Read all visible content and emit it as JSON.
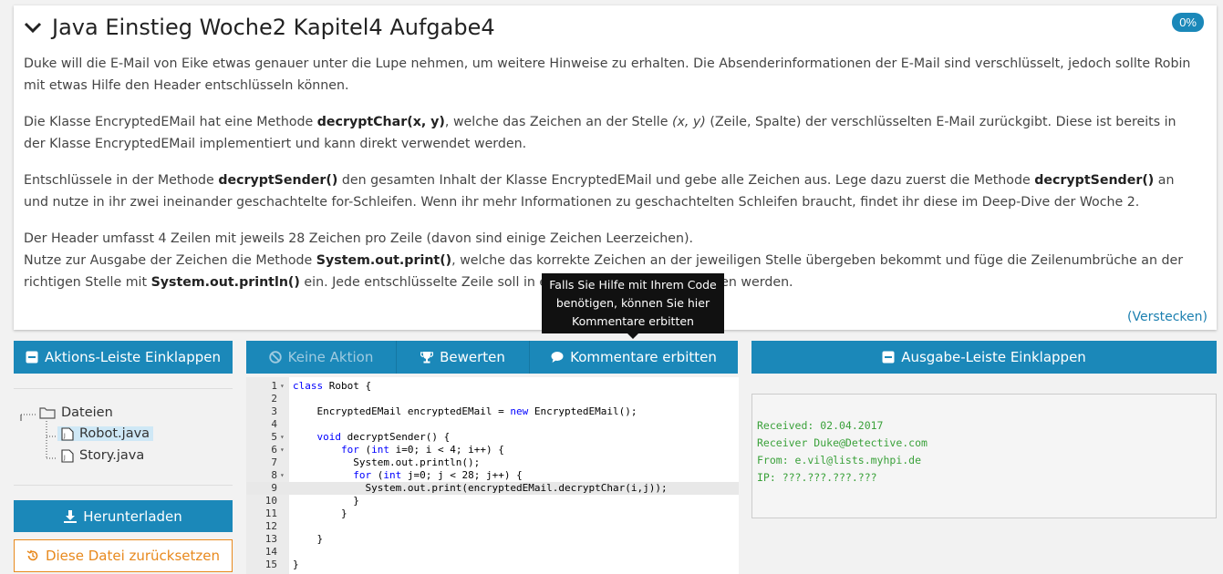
{
  "task": {
    "title": "Java Einstieg Woche2 Kapitel4 Aufgabe4",
    "progress": "0%",
    "p1": "Duke will die E-Mail von Eike etwas genauer unter die Lupe nehmen, um weitere Hinweise zu erhalten. Die Absenderinformationen der E-Mail sind verschlüsselt, jedoch sollte Robin mit etwas Hilfe den Header entschlüsseln können.",
    "p2_a": "Die Klasse EncryptedEMail hat eine Methode ",
    "p2_b": "decryptChar(x, y)",
    "p2_c": ", welche das Zeichen an der Stelle ",
    "p2_d": "(x, y)",
    "p2_e": " (Zeile, Spalte) der verschlüsselten E-Mail zurückgibt. Diese ist bereits in der Klasse EncryptedEMail implementiert und kann direkt verwendet werden.",
    "p3_a": "Entschlüssele in der Methode ",
    "p3_b": "decryptSender()",
    "p3_c": " den gesamten Inhalt der Klasse EncryptedEMail und gebe alle Zeichen aus. Lege dazu zuerst die Methode ",
    "p3_d": "decryptSender()",
    "p3_e": " an und nutze in ihr zwei ineinander geschachtelte for-Schleifen. Wenn ihr mehr Informationen zu geschachtelten Schleifen braucht, findet ihr diese im Deep-Dive der Woche 2.",
    "p4_a": "Der Header umfasst 4 Zeilen mit jeweils 28 Zeichen pro Zeile (davon sind einige Zeichen Leerzeichen).",
    "p4_b": "Nutze zur Ausgabe der Zeichen die Methode ",
    "p4_c": "System.out.print()",
    "p4_d": ", welche das korrekte Zeichen an der jeweiligen Stelle übergeben bekommt und füge die Zeilenumbrüche an der richtigen Stelle mit ",
    "p4_e": "System.out.println()",
    "p4_f": " ein. Jede entschlüsselte Zeile soll in einer neuen Zeile ausgegeben werden.",
    "hide_link": "(Verstecken)"
  },
  "tooltip": {
    "text": "Falls Sie Hilfe mit Ihrem Code benötigen, können Sie hier Kommentare erbitten"
  },
  "toolbar": {
    "collapse_actions": "Aktions-Leiste Einklappen",
    "no_action": "Keine Aktion",
    "rate": "Bewerten",
    "request_comments": "Kommentare erbitten",
    "collapse_output": "Ausgabe-Leiste Einklappen"
  },
  "files": {
    "folder": "Dateien",
    "items": [
      "Robot.java",
      "Story.java"
    ],
    "download": "Herunterladen",
    "reset": "Diese Datei zurücksetzen"
  },
  "code": {
    "lines": [
      "class Robot {",
      "",
      "    EncryptedEMail encryptedEMail = new EncryptedEMail();",
      "",
      "    void decryptSender() {",
      "        for (int i=0; i < 4; i++) {",
      "          System.out.println();",
      "          for (int j=0; j < 28; j++) {",
      "            System.out.print(encryptedEMail.decryptChar(i,j));",
      "          }",
      "        }",
      "",
      "    }",
      "",
      "}"
    ]
  },
  "output": {
    "lines": [
      "Received: 02.04.2017",
      "Receiver Duke@Detective.com",
      "From: e.vil@lists.myhpi.de",
      "IP: ???.???.???.???"
    ]
  },
  "colors": {
    "primary": "#1b88b9",
    "reset_orange": "#e8891d",
    "output_green": "#3aa13a"
  }
}
